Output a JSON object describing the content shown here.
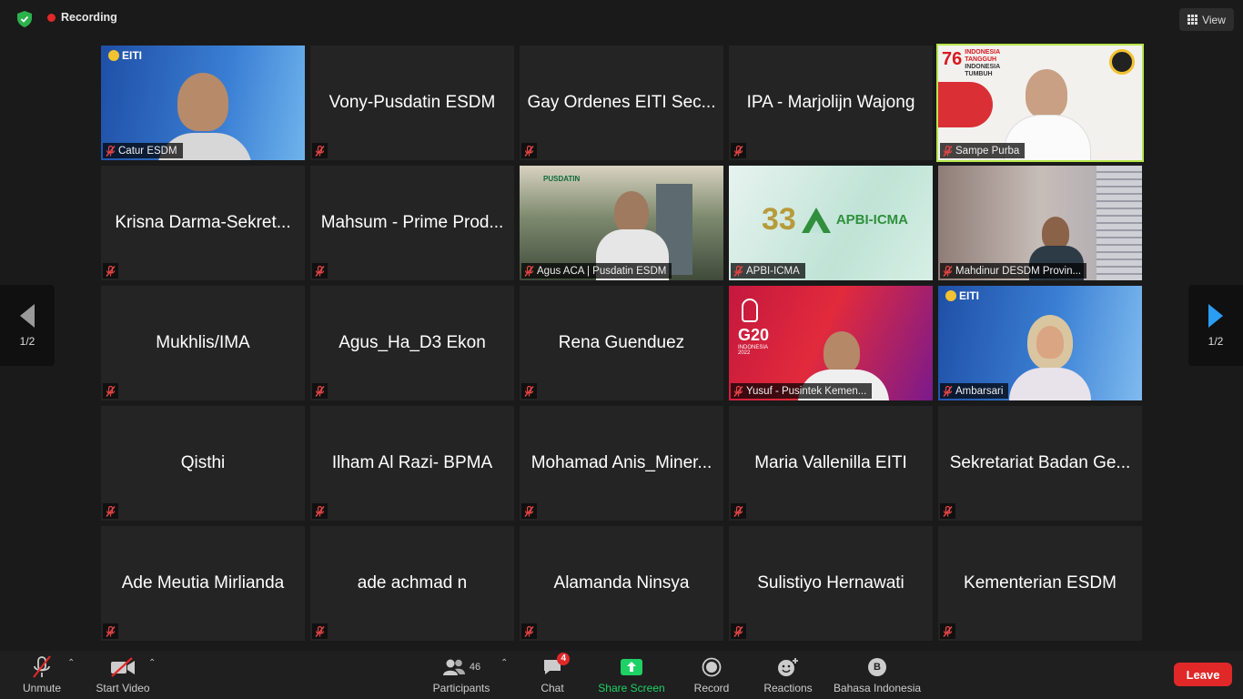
{
  "top": {
    "recording_label": "Recording",
    "view_label": "View"
  },
  "pager": {
    "left_label": "1/2",
    "right_label": "1/2"
  },
  "tiles": [
    {
      "name": "Catur ESDM",
      "video": true,
      "bg": "#2f6fc4"
    },
    {
      "name": "Vony-Pusdatin ESDM",
      "video": false
    },
    {
      "name": "Gay Ordenes EITI Sec...",
      "video": false
    },
    {
      "name": "IPA - Marjolijn Wajong",
      "video": false
    },
    {
      "name": "Sampe Purba",
      "video": true,
      "speaking": true,
      "bg": "#f3f1ee"
    },
    {
      "name": "Krisna Darma-Sekret...",
      "video": false
    },
    {
      "name": "Mahsum - Prime Prod...",
      "video": false
    },
    {
      "name": "Agus ACA | Pusdatin ESDM",
      "video": true,
      "bg": "#5a6b4c"
    },
    {
      "name": "APBI-ICMA",
      "video": true,
      "bg": "#cde7de"
    },
    {
      "name": "Mahdinur  DESDM Provin...",
      "video": true,
      "bg": "#b9b0ab"
    },
    {
      "name": "Mukhlis/IMA",
      "video": false
    },
    {
      "name": "Agus_Ha_D3 Ekon",
      "video": false
    },
    {
      "name": "Rena Guenduez",
      "video": false
    },
    {
      "name": "Yusuf - Pusintek Kemen...",
      "video": true,
      "bg": "#c2183a"
    },
    {
      "name": "Ambarsari",
      "video": true,
      "bg": "#3a7fd0"
    },
    {
      "name": "Qisthi",
      "video": false
    },
    {
      "name": "Ilham Al Razi- BPMA",
      "video": false
    },
    {
      "name": "Mohamad Anis_Miner...",
      "video": false
    },
    {
      "name": "Maria Vallenilla EITI",
      "video": false
    },
    {
      "name": "Sekretariat Badan Ge...",
      "video": false
    },
    {
      "name": "Ade Meutia Mirlianda",
      "video": false
    },
    {
      "name": "ade achmad n",
      "video": false
    },
    {
      "name": "Alamanda Ninsya",
      "video": false
    },
    {
      "name": "Sulistiyo Hernawati",
      "video": false
    },
    {
      "name": "Kementerian ESDM",
      "video": false
    }
  ],
  "logos": {
    "eiti_text": "EITI",
    "indonesia_text": "Indonesia",
    "apbi_text": "APBI-ICMA",
    "apbi_number": "33",
    "g20_text": "G20",
    "g20_sub": "INDONESIA",
    "g20_year": "2022",
    "pusdatin_text": "PUSDATIN",
    "anniv_number": "76",
    "anniv_line1": "INDONESIA",
    "anniv_line2": "TANGGUH",
    "anniv_line3": "INDONESIA",
    "anniv_line4": "TUMBUH"
  },
  "toolbar": {
    "unmute": "Unmute",
    "start_video": "Start Video",
    "participants": "Participants",
    "participants_count": "46",
    "chat": "Chat",
    "chat_badge": "4",
    "share_screen": "Share Screen",
    "record": "Record",
    "reactions": "Reactions",
    "language": "Bahasa Indonesia",
    "language_icon_letter": "B",
    "leave": "Leave"
  },
  "colors": {
    "share_green": "#1fd165",
    "leave_red": "#e02828",
    "speaking_border": "#b7e64a"
  }
}
